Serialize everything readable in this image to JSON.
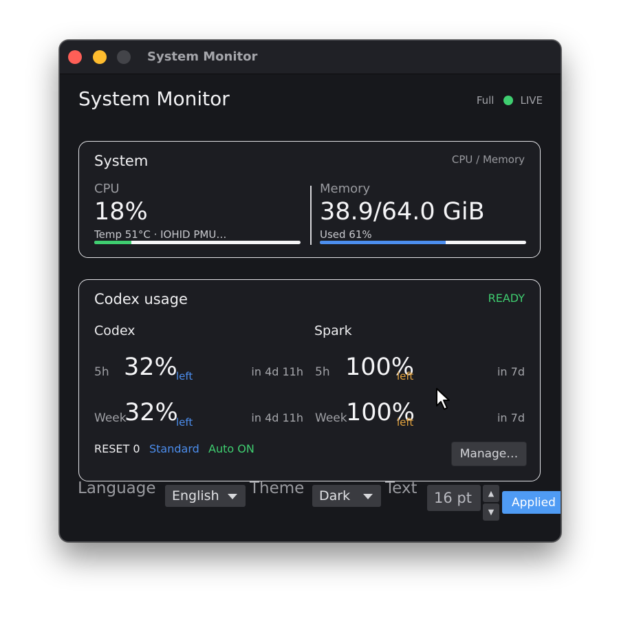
{
  "window": {
    "title": "System Monitor"
  },
  "header": {
    "title": "System Monitor",
    "mode": "Full",
    "live_label": "LIVE",
    "live_color": "#3fce70"
  },
  "system_card": {
    "title": "System",
    "subtitle": "CPU / Memory",
    "cpu": {
      "label": "CPU",
      "value": "18%",
      "detail": "Temp 51°C · IOHID PMU…",
      "level_fraction": 0.18,
      "bar_color": "#3fce70"
    },
    "memory": {
      "label": "Memory",
      "value": "38.9/64.0 GiB",
      "detail": "Used 61%",
      "level_fraction": 0.61,
      "bar_color": "#4c8eee"
    }
  },
  "codex_card": {
    "title": "Codex usage",
    "status": "READY",
    "status_color": "#3fce70",
    "codex": {
      "title": "Codex",
      "rows": [
        {
          "period": "5h",
          "percent": "32%",
          "suffix": "left",
          "reset": "in 4d 11h"
        },
        {
          "period": "Week",
          "percent": "32%",
          "suffix": "left",
          "reset": "in 4d 11h"
        }
      ]
    },
    "spark": {
      "title": "Spark",
      "rows": [
        {
          "period": "5h",
          "percent": "100%",
          "suffix": "left",
          "reset": "in 7d"
        },
        {
          "period": "Week",
          "percent": "100%",
          "suffix": "left",
          "reset": "in 7d"
        }
      ]
    },
    "footer": {
      "reset": "RESET 0",
      "plan": "Standard",
      "auto": "Auto ON",
      "manage_button": "Manage…"
    }
  },
  "settings": {
    "language_label": "Language",
    "language_value": "English",
    "theme_label": "Theme",
    "theme_value": "Dark",
    "text_label": "Text",
    "text_size_value": "16 pt",
    "apply_button": "Applied"
  },
  "icons": [
    "chevron-down-icon",
    "stepper-up-icon",
    "stepper-down-icon",
    "mouse-pointer-icon"
  ]
}
